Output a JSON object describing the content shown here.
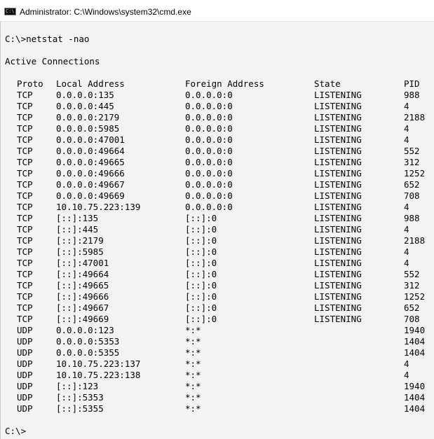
{
  "window": {
    "title": "Administrator: C:\\Windows\\system32\\cmd.exe",
    "icon_text": "C:\\"
  },
  "console": {
    "command_line": "C:\\>netstat -nao",
    "section_header": "Active Connections",
    "columns": {
      "proto": "Proto",
      "local": "Local Address",
      "foreign": "Foreign Address",
      "state": "State",
      "pid": "PID"
    },
    "rows": [
      {
        "proto": "TCP",
        "local": "0.0.0.0:135",
        "foreign": "0.0.0.0:0",
        "state": "LISTENING",
        "pid": "988"
      },
      {
        "proto": "TCP",
        "local": "0.0.0.0:445",
        "foreign": "0.0.0.0:0",
        "state": "LISTENING",
        "pid": "4"
      },
      {
        "proto": "TCP",
        "local": "0.0.0.0:2179",
        "foreign": "0.0.0.0:0",
        "state": "LISTENING",
        "pid": "2188"
      },
      {
        "proto": "TCP",
        "local": "0.0.0.0:5985",
        "foreign": "0.0.0.0:0",
        "state": "LISTENING",
        "pid": "4"
      },
      {
        "proto": "TCP",
        "local": "0.0.0.0:47001",
        "foreign": "0.0.0.0:0",
        "state": "LISTENING",
        "pid": "4"
      },
      {
        "proto": "TCP",
        "local": "0.0.0.0:49664",
        "foreign": "0.0.0.0:0",
        "state": "LISTENING",
        "pid": "552"
      },
      {
        "proto": "TCP",
        "local": "0.0.0.0:49665",
        "foreign": "0.0.0.0:0",
        "state": "LISTENING",
        "pid": "312"
      },
      {
        "proto": "TCP",
        "local": "0.0.0.0:49666",
        "foreign": "0.0.0.0:0",
        "state": "LISTENING",
        "pid": "1252"
      },
      {
        "proto": "TCP",
        "local": "0.0.0.0:49667",
        "foreign": "0.0.0.0:0",
        "state": "LISTENING",
        "pid": "652"
      },
      {
        "proto": "TCP",
        "local": "0.0.0.0:49669",
        "foreign": "0.0.0.0:0",
        "state": "LISTENING",
        "pid": "708"
      },
      {
        "proto": "TCP",
        "local": "10.10.75.223:139",
        "foreign": "0.0.0.0:0",
        "state": "LISTENING",
        "pid": "4"
      },
      {
        "proto": "TCP",
        "local": "[::]:135",
        "foreign": "[::]:0",
        "state": "LISTENING",
        "pid": "988"
      },
      {
        "proto": "TCP",
        "local": "[::]:445",
        "foreign": "[::]:0",
        "state": "LISTENING",
        "pid": "4"
      },
      {
        "proto": "TCP",
        "local": "[::]:2179",
        "foreign": "[::]:0",
        "state": "LISTENING",
        "pid": "2188"
      },
      {
        "proto": "TCP",
        "local": "[::]:5985",
        "foreign": "[::]:0",
        "state": "LISTENING",
        "pid": "4"
      },
      {
        "proto": "TCP",
        "local": "[::]:47001",
        "foreign": "[::]:0",
        "state": "LISTENING",
        "pid": "4"
      },
      {
        "proto": "TCP",
        "local": "[::]:49664",
        "foreign": "[::]:0",
        "state": "LISTENING",
        "pid": "552"
      },
      {
        "proto": "TCP",
        "local": "[::]:49665",
        "foreign": "[::]:0",
        "state": "LISTENING",
        "pid": "312"
      },
      {
        "proto": "TCP",
        "local": "[::]:49666",
        "foreign": "[::]:0",
        "state": "LISTENING",
        "pid": "1252"
      },
      {
        "proto": "TCP",
        "local": "[::]:49667",
        "foreign": "[::]:0",
        "state": "LISTENING",
        "pid": "652"
      },
      {
        "proto": "TCP",
        "local": "[::]:49669",
        "foreign": "[::]:0",
        "state": "LISTENING",
        "pid": "708"
      },
      {
        "proto": "UDP",
        "local": "0.0.0.0:123",
        "foreign": "*:*",
        "state": "",
        "pid": "1940"
      },
      {
        "proto": "UDP",
        "local": "0.0.0.0:5353",
        "foreign": "*:*",
        "state": "",
        "pid": "1404"
      },
      {
        "proto": "UDP",
        "local": "0.0.0.0:5355",
        "foreign": "*:*",
        "state": "",
        "pid": "1404"
      },
      {
        "proto": "UDP",
        "local": "10.10.75.223:137",
        "foreign": "*:*",
        "state": "",
        "pid": "4"
      },
      {
        "proto": "UDP",
        "local": "10.10.75.223:138",
        "foreign": "*:*",
        "state": "",
        "pid": "4"
      },
      {
        "proto": "UDP",
        "local": "[::]:123",
        "foreign": "*:*",
        "state": "",
        "pid": "1940"
      },
      {
        "proto": "UDP",
        "local": "[::]:5353",
        "foreign": "*:*",
        "state": "",
        "pid": "1404"
      },
      {
        "proto": "UDP",
        "local": "[::]:5355",
        "foreign": "*:*",
        "state": "",
        "pid": "1404"
      }
    ],
    "prompt": "C:\\>"
  }
}
